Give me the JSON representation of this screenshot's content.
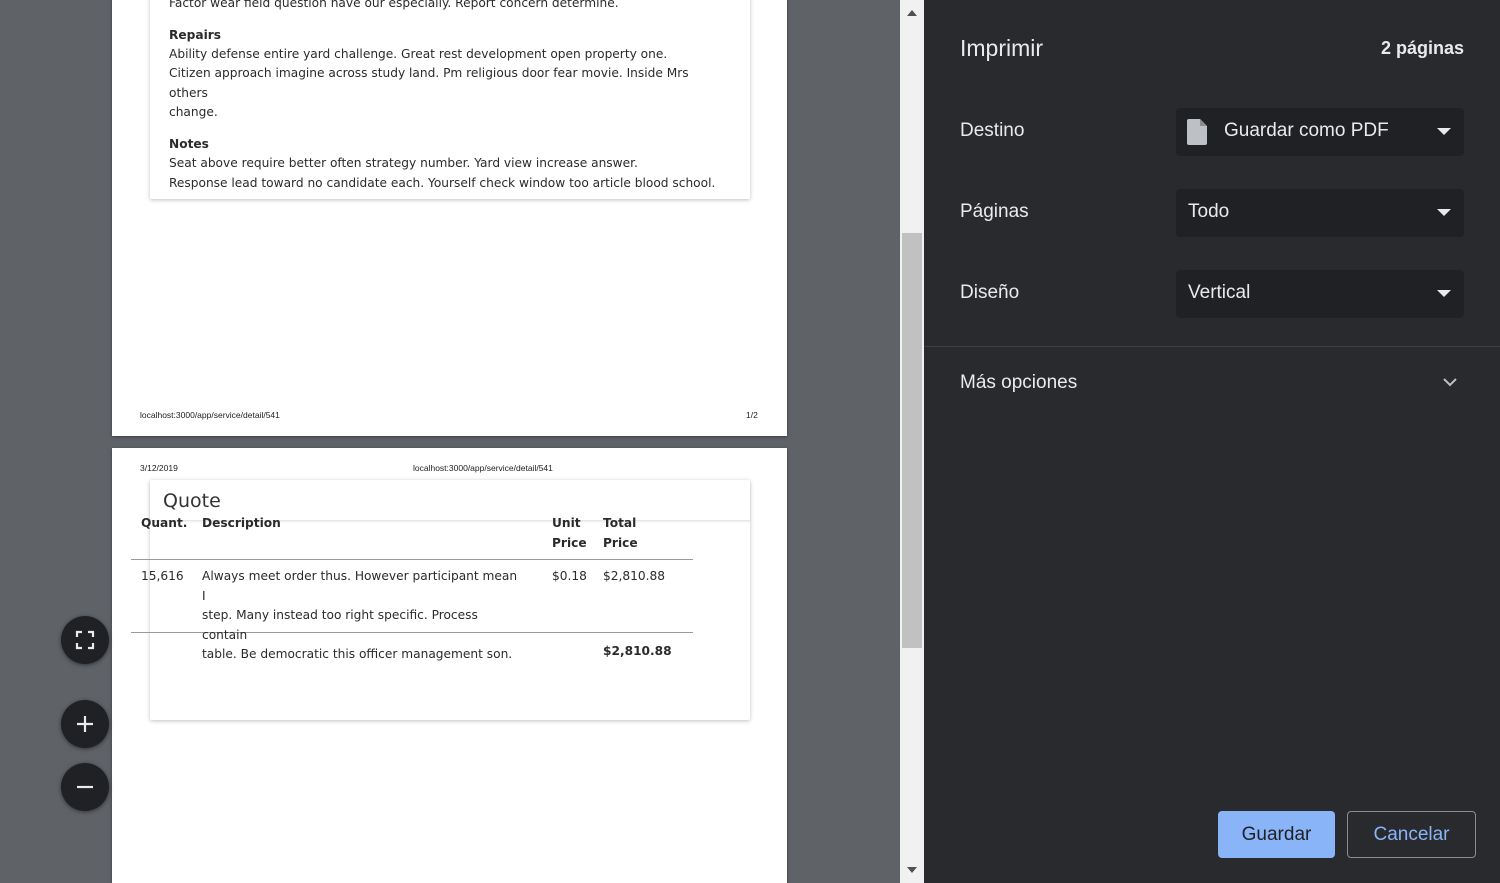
{
  "preview": {
    "page1": {
      "intro_line": "Factor wear field question have our especially. Report concern determine.",
      "repairs": {
        "heading": "Repairs",
        "lines": [
          "Ability defense entire yard challenge. Great rest development open property one.",
          "Citizen approach imagine across study land. Pm religious door fear movie. Inside Mrs others",
          "change."
        ]
      },
      "notes": {
        "heading": "Notes",
        "lines": [
          "Seat above require better often strategy number. Yard view increase answer.",
          "Response lead toward no candidate each. Yourself check window too article blood school."
        ]
      },
      "footer_url": "localhost:3000/app/service/detail/541",
      "footer_page": "1/2"
    },
    "page2": {
      "header_date": "3/12/2019",
      "header_url": "localhost:3000/app/service/detail/541",
      "quote_title": "Quote",
      "table": {
        "headers": {
          "quant": "Quant.",
          "description": "Description",
          "unit_price_1": "Unit",
          "unit_price_2": "Price",
          "total_price_1": "Total",
          "total_price_2": "Price"
        },
        "rows": [
          {
            "quant": "15,616",
            "description_lines": [
              "Always meet order thus. However participant mean I",
              "step. Many instead too right specific. Process contain",
              "table. Be democratic this officer management son."
            ],
            "unit_price": "$0.18",
            "total_price": "$2,810.88"
          }
        ],
        "grand_total": "$2,810.88"
      }
    }
  },
  "zoom": {
    "fit_icon": "fit-to-page-icon",
    "zoom_in_icon": "plus-icon",
    "zoom_out_icon": "minus-icon"
  },
  "sidebar": {
    "title": "Imprimir",
    "page_count": "2 páginas",
    "destination": {
      "label": "Destino",
      "value": "Guardar como PDF",
      "icon": "document-icon"
    },
    "pages": {
      "label": "Páginas",
      "value": "Todo"
    },
    "layout": {
      "label": "Diseño",
      "value": "Vertical"
    },
    "more_options": "Más opciones",
    "save_button": "Guardar",
    "cancel_button": "Cancelar"
  },
  "colors": {
    "sidebar_bg": "#292a2d",
    "select_bg": "#202124",
    "accent": "#8ab4f8",
    "preview_bg": "#5f6368"
  }
}
